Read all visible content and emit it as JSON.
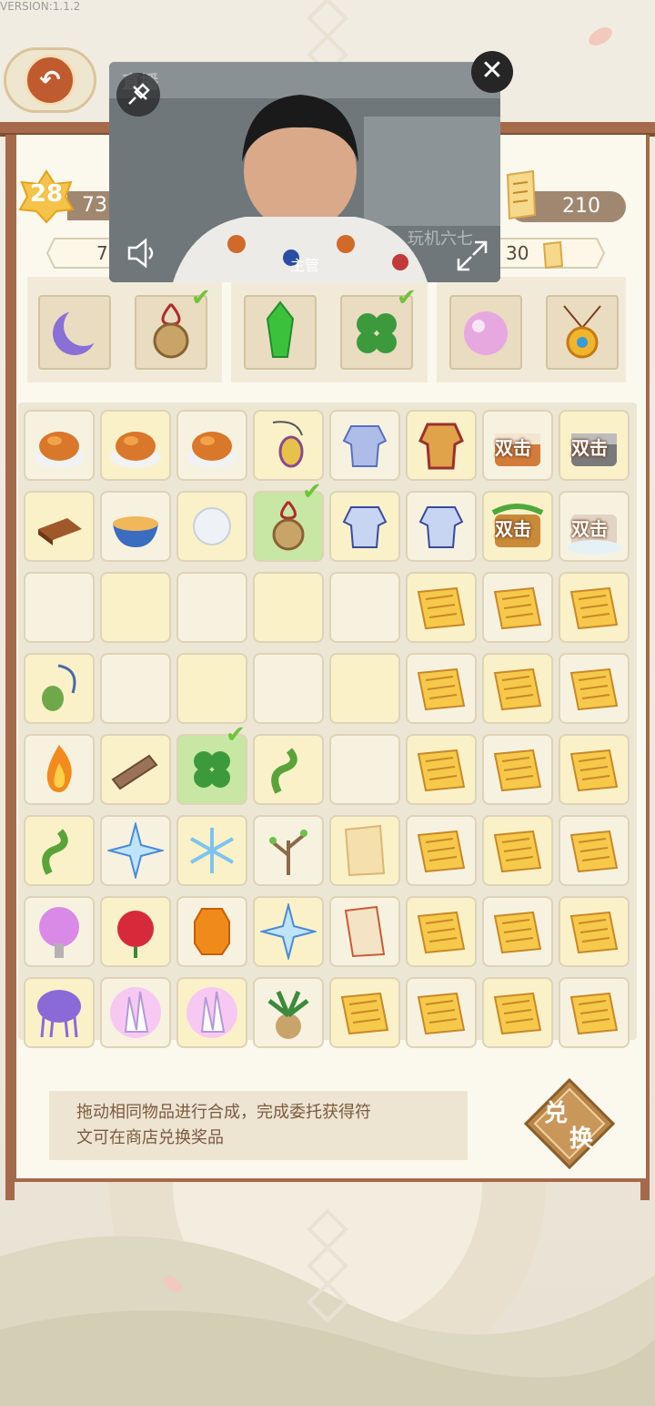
{
  "version": "VERSION:1.1.2",
  "player": {
    "level": "28",
    "xp_value": "73",
    "runes": "210"
  },
  "commission_left": {
    "value": "7"
  },
  "commission_right": {
    "value": "30"
  },
  "orders": [
    {
      "icon": "crescent-moon-icon",
      "done": false
    },
    {
      "icon": "jade-pendant-icon",
      "done": true
    },
    {
      "icon": "green-crystal-icon",
      "done": false
    },
    {
      "icon": "four-leaf-clover-icon",
      "done": true
    },
    {
      "icon": "pink-pearl-icon",
      "done": false
    },
    {
      "icon": "gold-amulet-icon",
      "done": false
    }
  ],
  "grid": {
    "rows": [
      [
        "roast-chicken",
        "roast-chicken",
        "roast-chicken",
        "pouch-necklace",
        "blue-armor",
        "gold-armor",
        "double-chest-red",
        "double-chest-silver"
      ],
      [
        "chocolate",
        "noodle-bowl",
        "white-pearl",
        "jade-pendant",
        "blue-armor-2",
        "blue-armor-2",
        "double-chest-green",
        "double-chest-cloud"
      ],
      [
        "empty",
        "empty",
        "empty",
        "empty",
        "empty",
        "scroll",
        "scroll",
        "scroll"
      ],
      [
        "gourd-necklace",
        "empty",
        "empty",
        "empty",
        "empty",
        "scroll",
        "scroll",
        "scroll"
      ],
      [
        "flame",
        "wood-log",
        "four-leaf-clover",
        "vine",
        "empty",
        "scroll",
        "scroll",
        "scroll"
      ],
      [
        "vine",
        "ice-star",
        "snowflake",
        "branch",
        "paper-note",
        "scroll",
        "scroll",
        "scroll"
      ],
      [
        "purple-tree",
        "rose",
        "amber-gem",
        "ice-star",
        "paper-scroll",
        "scroll",
        "scroll",
        "scroll"
      ],
      [
        "purple-jellyfish",
        "crystal-cluster",
        "crystal-cluster",
        "palm-pot",
        "scroll",
        "scroll",
        "scroll",
        "scroll"
      ]
    ],
    "double_label": "双击"
  },
  "hint": {
    "line1": "拖动相同物品进行合成，完成委托获得符",
    "line2": "文可在商店兑换奖品"
  },
  "exchange": {
    "char1": "兑",
    "char2": "换"
  },
  "video": {
    "watermark": "直播",
    "caption": "主管",
    "logo": "玩机六七"
  }
}
